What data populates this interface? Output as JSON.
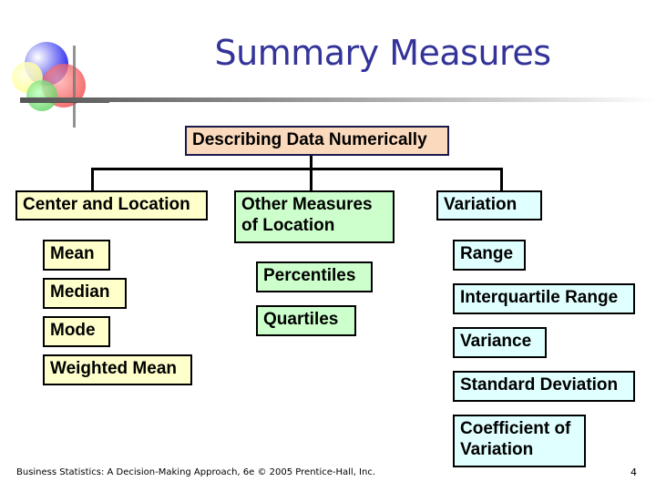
{
  "slide": {
    "title": "Summary Measures",
    "footer": "Business Statistics: A Decision-Making Approach, 6e © 2005 Prentice-Hall, Inc.",
    "page_number": "4",
    "logo_icon": "overlapping-circles-logo-icon"
  },
  "diagram": {
    "root": "Describing Data Numerically",
    "branches": [
      {
        "label": "Center and Location",
        "color": "#ffffcc",
        "children": [
          "Mean",
          "Median",
          "Mode",
          "Weighted Mean"
        ]
      },
      {
        "label_line1": "Other Measures",
        "label_line2": "of Location",
        "color": "#ccffcc",
        "children": [
          "Percentiles",
          "Quartiles"
        ]
      },
      {
        "label": "Variation",
        "color": "#e0ffff",
        "children": [
          "Range",
          "Interquartile Range",
          "Variance",
          "Standard Deviation"
        ],
        "last_child_line1": "Coefficient of",
        "last_child_line2": "Variation"
      }
    ]
  },
  "colors": {
    "title": "#333399",
    "root_fill": "#fbd9bd"
  }
}
